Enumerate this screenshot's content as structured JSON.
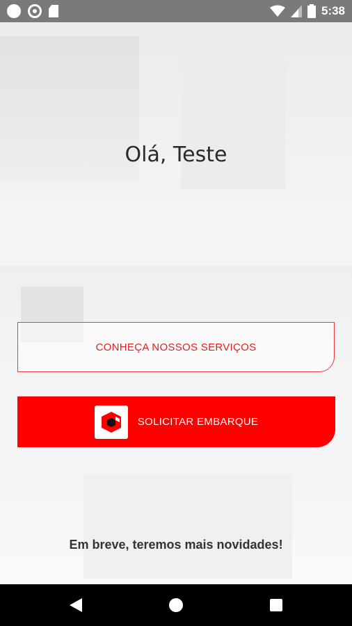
{
  "status_bar": {
    "time": "5:38",
    "icons": [
      "notification-dot-icon",
      "sync-icon",
      "sd-card-icon",
      "wifi-icon",
      "signal-icon",
      "battery-icon"
    ]
  },
  "main": {
    "greeting": "Olá, Teste",
    "services_button": "CONHEÇA NOSSOS SERVIÇOS",
    "embark_button": "SOLICITAR EMBARQUE",
    "footer_text": "Em breve, teremos  mais novidades!"
  },
  "nav_bar": {
    "icons": [
      "back-icon",
      "home-icon",
      "recents-icon"
    ]
  },
  "colors": {
    "accent": "#ff0000",
    "status_bar": "#7a7a7a",
    "nav_bar": "#000000"
  }
}
